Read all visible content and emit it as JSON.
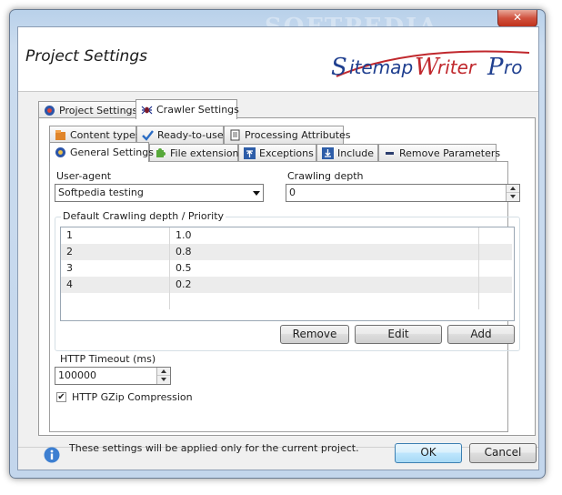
{
  "window": {
    "watermark": "SOFTPEDIA",
    "close_glyph": "✕"
  },
  "header": {
    "title": "Project Settings",
    "logo_text": [
      "S",
      "itemap",
      "W",
      "riter",
      "P",
      "ro"
    ]
  },
  "top_tabs": [
    {
      "label": "Project Settings",
      "icon": "gear-icon",
      "active": false
    },
    {
      "label": "Crawler Settings",
      "icon": "spider-icon",
      "active": true
    }
  ],
  "sub_tabs_row1": [
    {
      "label": "Content types",
      "icon": "folder-icon"
    },
    {
      "label": "Ready-to-use",
      "icon": "checkmark-icon"
    },
    {
      "label": "Processing Attributes",
      "icon": "document-icon"
    }
  ],
  "sub_tabs_row2": [
    {
      "label": "General Settings",
      "icon": "gear-icon",
      "active": true
    },
    {
      "label": "File extension",
      "icon": "puzzle-icon"
    },
    {
      "label": "Exceptions",
      "icon": "arrow-up-bar-icon"
    },
    {
      "label": "Include",
      "icon": "arrow-down-bar-icon"
    },
    {
      "label": "Remove Parameters",
      "icon": "minus-icon"
    }
  ],
  "general": {
    "user_agent_label": "User-agent",
    "user_agent_value": "Softpedia testing",
    "crawling_depth_label": "Crawling depth",
    "crawling_depth_value": "0",
    "group_label": "Default Crawling depth / Priority",
    "rows": [
      {
        "depth": "1",
        "priority": "1.0"
      },
      {
        "depth": "2",
        "priority": "0.8"
      },
      {
        "depth": "3",
        "priority": "0.5"
      },
      {
        "depth": "4",
        "priority": "0.2"
      }
    ],
    "buttons": {
      "remove": "Remove",
      "edit": "Edit",
      "add": "Add"
    },
    "http_timeout_label": "HTTP Timeout (ms)",
    "http_timeout_value": "100000",
    "gzip_label": "HTTP GZip Compression",
    "gzip_checked": true,
    "check_glyph": "✔"
  },
  "footer": {
    "info": "These settings will be applied only for the current project.",
    "ok": "OK",
    "cancel": "Cancel"
  },
  "colors": {
    "logo_blue": "#1f3f8f",
    "logo_red": "#c0282d",
    "accent_blue": "#3c7fb1"
  }
}
